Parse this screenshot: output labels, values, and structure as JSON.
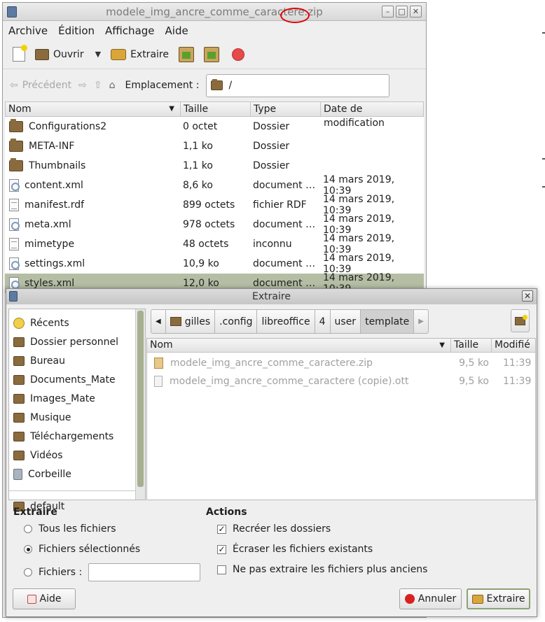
{
  "main_window": {
    "title": "modele_img_ancre_comme_caractere.zip",
    "menu": [
      "Archive",
      "Édition",
      "Affichage",
      "Aide"
    ],
    "toolbar": {
      "open_label": "Ouvrir",
      "extract_label": "Extraire"
    },
    "location": {
      "back_label": "Précédent",
      "label": "Emplacement :",
      "value": "/"
    },
    "columns": [
      "Nom",
      "Taille",
      "Type",
      "Date de modification"
    ],
    "files": [
      {
        "name": "Configurations2",
        "size": "0 octet",
        "type": "Dossier",
        "date": "",
        "icon": "folder-icon"
      },
      {
        "name": "META-INF",
        "size": "1,1 ko",
        "type": "Dossier",
        "date": "",
        "icon": "folder-icon"
      },
      {
        "name": "Thumbnails",
        "size": "1,1 ko",
        "type": "Dossier",
        "date": "",
        "icon": "folder-icon"
      },
      {
        "name": "content.xml",
        "size": "8,6 ko",
        "type": "document …",
        "date": "14 mars 2019, 10:39",
        "icon": "xml-file-icon"
      },
      {
        "name": "manifest.rdf",
        "size": "899 octets",
        "type": "fichier RDF",
        "date": "14 mars 2019, 10:39",
        "icon": "text-file-icon"
      },
      {
        "name": "meta.xml",
        "size": "978 octets",
        "type": "document …",
        "date": "14 mars 2019, 10:39",
        "icon": "xml-file-icon"
      },
      {
        "name": "mimetype",
        "size": "48 octets",
        "type": "inconnu",
        "date": "14 mars 2019, 10:39",
        "icon": "text-file-icon"
      },
      {
        "name": "settings.xml",
        "size": "10,9 ko",
        "type": "document …",
        "date": "14 mars 2019, 10:39",
        "icon": "xml-file-icon"
      },
      {
        "name": "styles.xml",
        "size": "12,0 ko",
        "type": "document …",
        "date": "14 mars 2019, 10:39",
        "icon": "xml-file-icon",
        "selected": true
      }
    ]
  },
  "dialog": {
    "title": "Extraire",
    "places": [
      "Récents",
      "Dossier personnel",
      "Bureau",
      "Documents_Mate",
      "Images_Mate",
      "Musique",
      "Téléchargements",
      "Vidéos",
      "Corbeille"
    ],
    "bookmark": "default",
    "path": [
      "gilles",
      ".config",
      "libreoffice",
      "4",
      "user",
      "template"
    ],
    "columns": [
      "Nom",
      "Taille",
      "Modifié"
    ],
    "files": [
      {
        "name": "modele_img_ancre_comme_caractere.zip",
        "size": "9,5 ko",
        "modified": "11:39",
        "icon": "zip-icon"
      },
      {
        "name": "modele_img_ancre_comme_caractere (copie).ott",
        "size": "9,5 ko",
        "modified": "11:39",
        "icon": "document-icon"
      }
    ],
    "extract_section": "Extraire",
    "extract_options": [
      "Tous les fichiers",
      "Fichiers sélectionnés",
      "Fichiers :"
    ],
    "extract_selected": "Fichiers sélectionnés",
    "files_filter_value": "",
    "actions_section": "Actions",
    "actions": [
      {
        "label": "Recréer les dossiers",
        "checked": true
      },
      {
        "label": "Écraser les fichiers existants",
        "checked": true
      },
      {
        "label": "Ne pas extraire les fichiers plus anciens",
        "checked": false
      }
    ],
    "buttons": {
      "help": "Aide",
      "cancel": "Annuler",
      "extract": "Extraire"
    }
  }
}
